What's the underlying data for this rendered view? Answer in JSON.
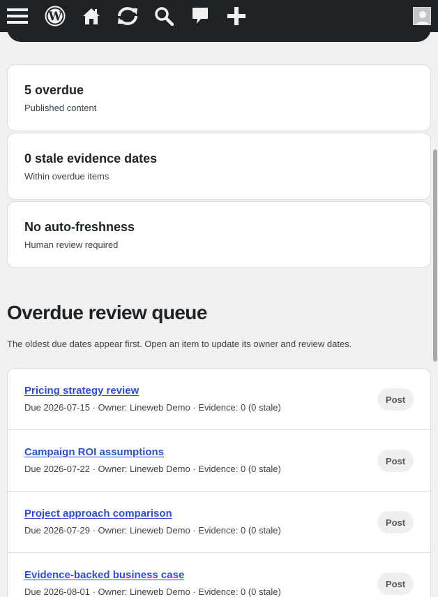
{
  "adminbar": {
    "icons": [
      "menu-icon",
      "wordpress-logo-icon",
      "home-icon",
      "updates-icon",
      "search-icon",
      "comments-icon",
      "add-new-icon",
      "user-avatar"
    ]
  },
  "stats": [
    {
      "title": "5 overdue",
      "subtitle": "Published content"
    },
    {
      "title": "0 stale evidence dates",
      "subtitle": "Within overdue items"
    },
    {
      "title": "No auto-freshness",
      "subtitle": "Human review required"
    }
  ],
  "queue_section": {
    "title": "Overdue review queue",
    "description": "The oldest due dates appear first. Open an item to update its owner and review dates."
  },
  "queue": [
    {
      "title": "Pricing strategy review",
      "meta": "Due 2026-07-15 · Owner: Lineweb Demo · Evidence: 0 (0 stale)",
      "type": "Post"
    },
    {
      "title": "Campaign ROI assumptions",
      "meta": "Due 2026-07-22 · Owner: Lineweb Demo · Evidence: 0 (0 stale)",
      "type": "Post"
    },
    {
      "title": "Project approach comparison",
      "meta": "Due 2026-07-29 · Owner: Lineweb Demo · Evidence: 0 (0 stale)",
      "type": "Post"
    },
    {
      "title": "Evidence-backed business case",
      "meta": "Due 2026-08-01 · Owner: Lineweb Demo · Evidence: 0 (0 stale)",
      "type": "Post"
    }
  ],
  "colors": {
    "adminbar_bg": "#1d2327",
    "link": "#2c4fd6",
    "badge_bg": "#efefef",
    "page_bg": "#f0f0f1"
  }
}
